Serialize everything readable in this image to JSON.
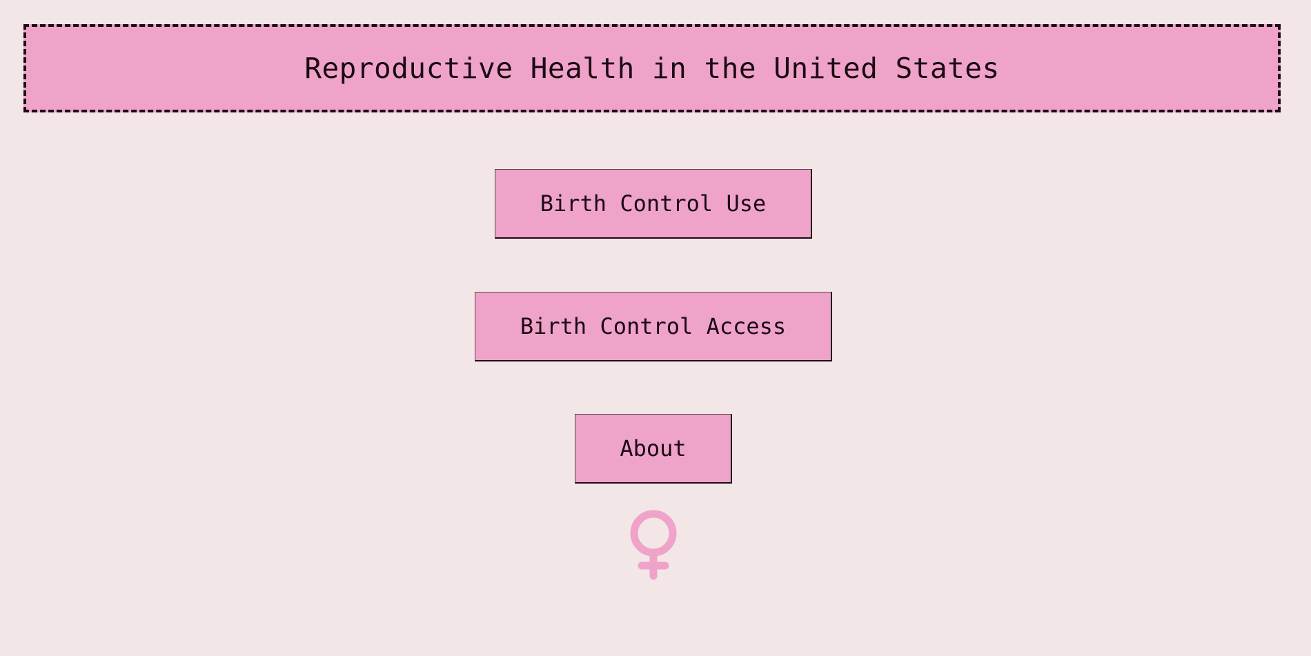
{
  "header": {
    "title": "Reproductive Health in the United States"
  },
  "nav": {
    "items": [
      {
        "label": "Birth Control Use"
      },
      {
        "label": "Birth Control Access"
      },
      {
        "label": "About"
      }
    ]
  },
  "icons": {
    "logo": "female-symbol-icon"
  },
  "colors": {
    "background": "#f2e6e7",
    "accent_pink": "#f0a3c8",
    "text": "#1a0a14"
  }
}
